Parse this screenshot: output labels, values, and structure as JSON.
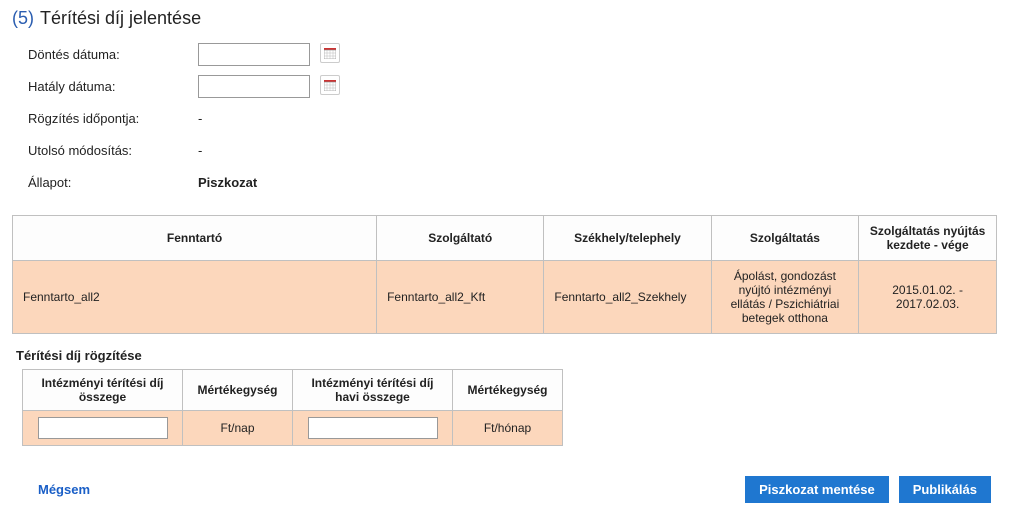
{
  "section": {
    "number": "(5)",
    "title": "Térítési díj jelentése"
  },
  "form": {
    "dontes_label": "Döntés dátuma:",
    "dontes_value": "",
    "hataly_label": "Hatály dátuma:",
    "hataly_value": "",
    "rogzites_label": "Rögzítés időpontja:",
    "rogzites_value": "-",
    "modositas_label": "Utolsó módosítás:",
    "modositas_value": "-",
    "allapot_label": "Állapot:",
    "allapot_value": "Piszkozat"
  },
  "main_table": {
    "headers": {
      "fenntarto": "Fenntartó",
      "szolgaltato": "Szolgáltató",
      "szekhely": "Székhely/telephely",
      "szolgaltatas": "Szolgáltatás",
      "kezdet_vege": "Szolgáltatás nyújtás kezdete - vége"
    },
    "row": {
      "fenntarto": "Fenntarto_all2",
      "szolgaltato": "Fenntarto_all2_Kft",
      "szekhely": "Fenntarto_all2_Szekhely",
      "szolgaltatas": "Ápolást, gondozást nyújtó intézményi ellátás / Pszichiátriai betegek otthona",
      "kezdet_vege": "2015.01.02. - 2017.02.03."
    }
  },
  "sub_section_title": "Térítési díj rögzítése",
  "fee_table": {
    "headers": {
      "osszeg": "Intézményi térítési díj összege",
      "egyseg1": "Mértékegység",
      "havi": "Intézményi térítési díj havi összege",
      "egyseg2": "Mértékegység"
    },
    "row": {
      "osszeg_value": "",
      "unit1": "Ft/nap",
      "havi_value": "",
      "unit2": "Ft/hónap"
    }
  },
  "buttons": {
    "cancel": "Mégsem",
    "save_draft": "Piszkozat mentése",
    "publish": "Publikálás"
  }
}
